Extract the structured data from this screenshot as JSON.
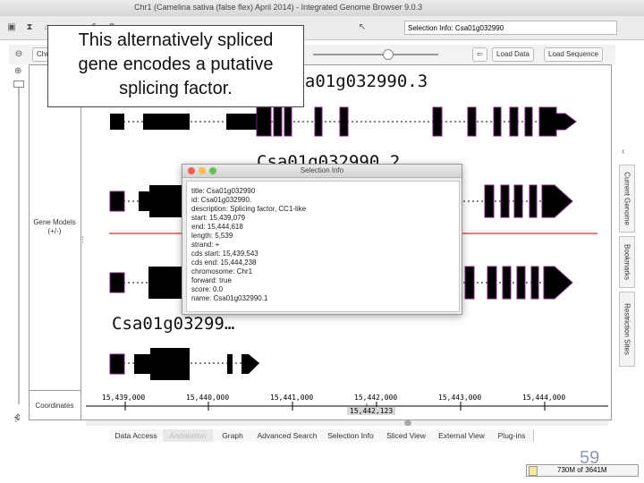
{
  "window": {
    "title": "Chr1 (Camelina sativa (false flex) April 2014) - Integrated Genome Browser 9.0.3"
  },
  "toolbar": {
    "selection_info": "Selection Info:  Csa01g032990"
  },
  "navbar": {
    "chr_label": "Chr",
    "load_data": "Load Data",
    "load_sequence": "Load Sequence"
  },
  "callout": {
    "lines": [
      "This alternatively spliced",
      "gene encodes a putative",
      "splicing factor."
    ]
  },
  "tracks": {
    "names": [
      "Csa01g032990.3",
      "Csa01g032990.2",
      "Csa01g03299…"
    ],
    "gene_models_label": "Gene Models",
    "gene_models_strand": "(+/-)",
    "coordinates_label": "Coordinates",
    "coords": [
      "15,439,000",
      "15,440,000",
      "15,441,000",
      "15,442,000",
      "15,443,000",
      "15,444,000"
    ],
    "cursor_coord": "15,442,123"
  },
  "dialog": {
    "title": "Selection Info",
    "lines": [
      "title: Csa01g032990",
      "id: Csa01g032990.",
      "description: Splicing factor, CC1-like",
      "start: 15,439,079",
      "end: 15,444,618",
      "length: 5,539",
      "strand: +",
      "cds start: 15,439,543",
      "cds end: 15,444,238",
      "chromosome: Chr1",
      "forward: true",
      "score: 0.0",
      "name: Csa01g032990.1"
    ]
  },
  "right_tabs": [
    "Current Genome",
    "Bookmarks",
    "Restriction Sites"
  ],
  "bottom_tabs": [
    "Data Access",
    "Annotation",
    "Graph",
    "Advanced Search",
    "Selection Info",
    "Sliced View",
    "External View",
    "Plug-ins"
  ],
  "status": {
    "memory": "730M of 3641M",
    "slide_number": "59"
  },
  "colors": {
    "exon": "#000000",
    "exon_border": "#7a1f7a",
    "selection_line": "#c0392b"
  }
}
